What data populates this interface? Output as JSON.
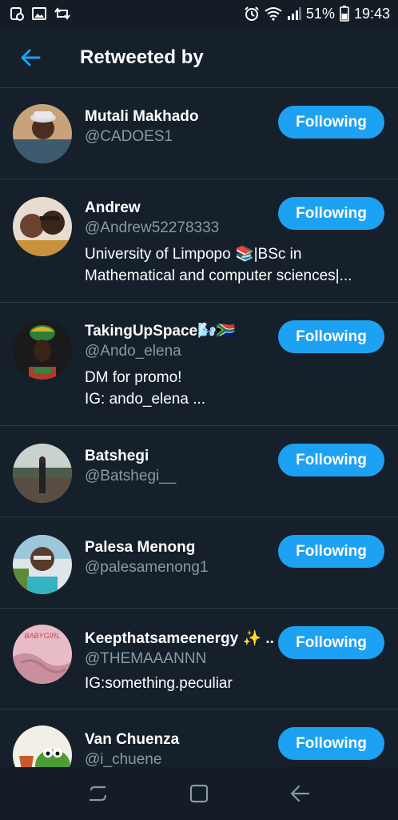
{
  "status_bar": {
    "battery_percent": "51%",
    "time": "19:43",
    "icons": [
      "notification-icon",
      "gallery-icon",
      "sync-icon",
      "alarm-icon",
      "wifi-icon",
      "signal-icon",
      "battery-icon"
    ]
  },
  "header": {
    "title": "Retweeted by",
    "back_icon": "back-arrow-icon"
  },
  "accent_color": "#1da1f2",
  "users": [
    {
      "name": "Mutali Makhado",
      "handle": "@CADOES1",
      "bio": [],
      "button": "Following"
    },
    {
      "name": "Andrew",
      "handle": "@Andrew52278333",
      "bio": [
        "University of Limpopo 📚|BSc in",
        "Mathematical and computer sciences|..."
      ],
      "button": "Following"
    },
    {
      "name": "TakingUpSpace🌬️🇿🇦",
      "handle": "@Ando_elena",
      "bio": [
        "DM for promo!",
        "IG: ando_elena ..."
      ],
      "button": "Following"
    },
    {
      "name": "Batshegi",
      "handle": "@Batshegi__",
      "bio": [],
      "button": "Following"
    },
    {
      "name": "Palesa Menong",
      "handle": "@palesamenong1",
      "bio": [],
      "button": "Following"
    },
    {
      "name": "Keepthatsameenergy ✨ ...",
      "handle": "@THEMAAANNN",
      "bio": [
        "IG:something.peculiar"
      ],
      "button": "Following",
      "avatar_text": "BABYGIRL"
    },
    {
      "name": "Van Chuenza",
      "handle": "@i_chuene",
      "bio": [],
      "button": "Following"
    }
  ],
  "nav_bar": {
    "icons": [
      "recent-apps-icon",
      "home-icon",
      "back-icon"
    ]
  }
}
